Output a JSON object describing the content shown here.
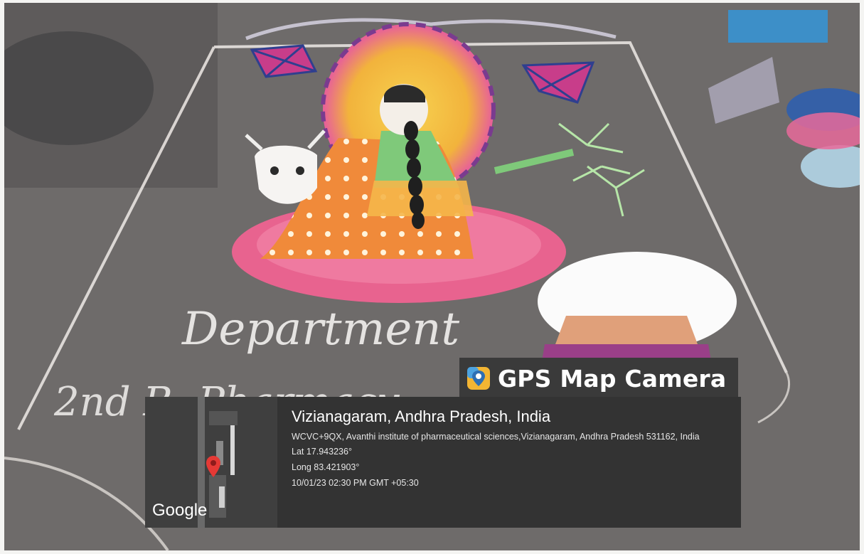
{
  "overlay": {
    "app_title": "GPS Map Camera",
    "location_title": "Vizianagaram, Andhra Pradesh, India",
    "address": "WCVC+9QX, Avanthi institute of pharmaceutical sciences,Vizianagaram, Andhra Pradesh 531162, India",
    "latitude": "Lat 17.943236°",
    "longitude": "Long 83.421903°",
    "datetime": "10/01/23 02:30 PM GMT +05:30",
    "map_brand": "Google"
  },
  "photo": {
    "handwritten_text": [
      "Department",
      "2nd B. Pharmacy"
    ],
    "subject": "rangoli",
    "colors": {
      "ground": "#6d6a69",
      "chalk": "#f2f0ee",
      "pink": "#e86a9a",
      "orange": "#f08a3a",
      "yellow": "#f5c24a",
      "green": "#7fc97a",
      "purple": "#7a3b8f",
      "blue": "#3d8fc8"
    }
  },
  "icons": {
    "app_icon": "map-pin-icon",
    "map_pin": "location-pin-icon"
  }
}
